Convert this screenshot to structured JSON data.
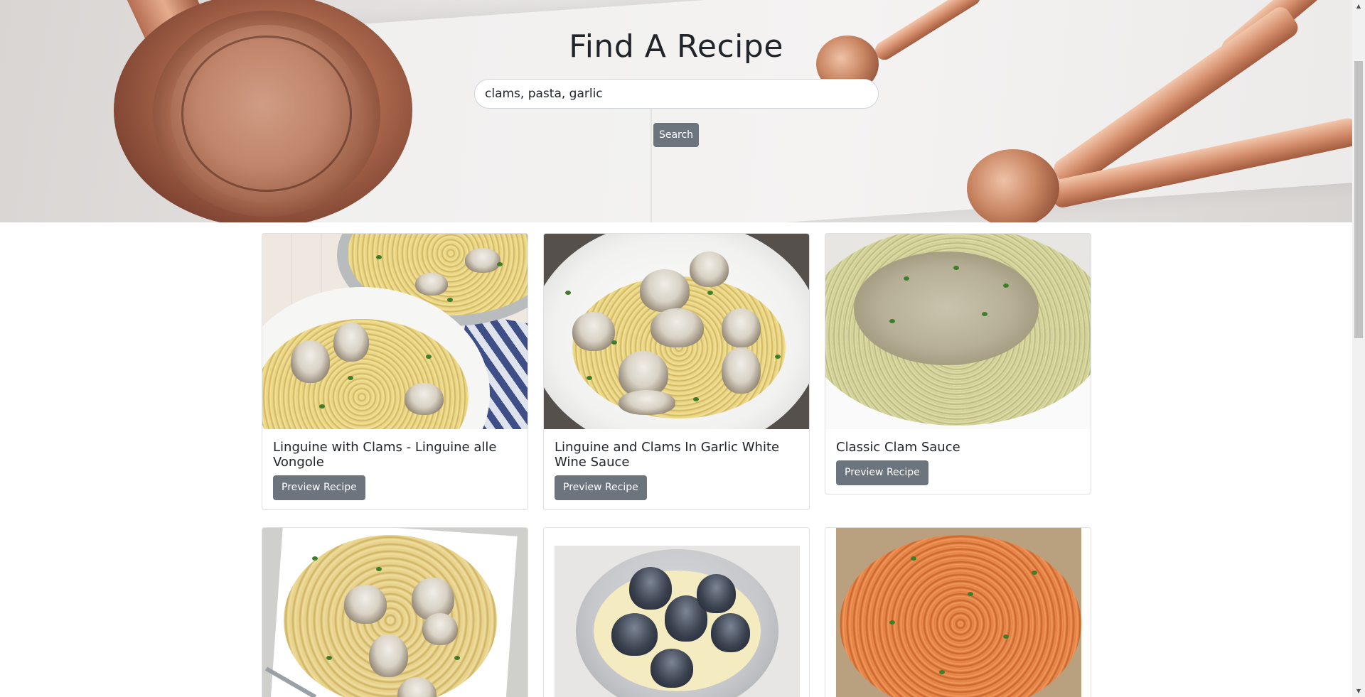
{
  "hero": {
    "title": "Find A Recipe",
    "search_value": "clams, pasta, garlic",
    "search_button": "Search"
  },
  "recipes": [
    {
      "title": "Linguine with Clams - Linguine alle Vongole",
      "button": "Preview Recipe"
    },
    {
      "title": "Linguine and Clams In Garlic White Wine Sauce",
      "button": "Preview Recipe"
    },
    {
      "title": "Classic Clam Sauce",
      "button": "Preview Recipe"
    },
    {
      "title": "",
      "button": ""
    },
    {
      "title": "",
      "button": ""
    },
    {
      "title": "",
      "button": ""
    }
  ],
  "colors": {
    "button_bg": "#6c757d",
    "text": "#212529",
    "copper": "#c98663"
  },
  "icons": {
    "scroll_up": "triangle-up-icon",
    "scroll_down": "triangle-down-icon"
  }
}
